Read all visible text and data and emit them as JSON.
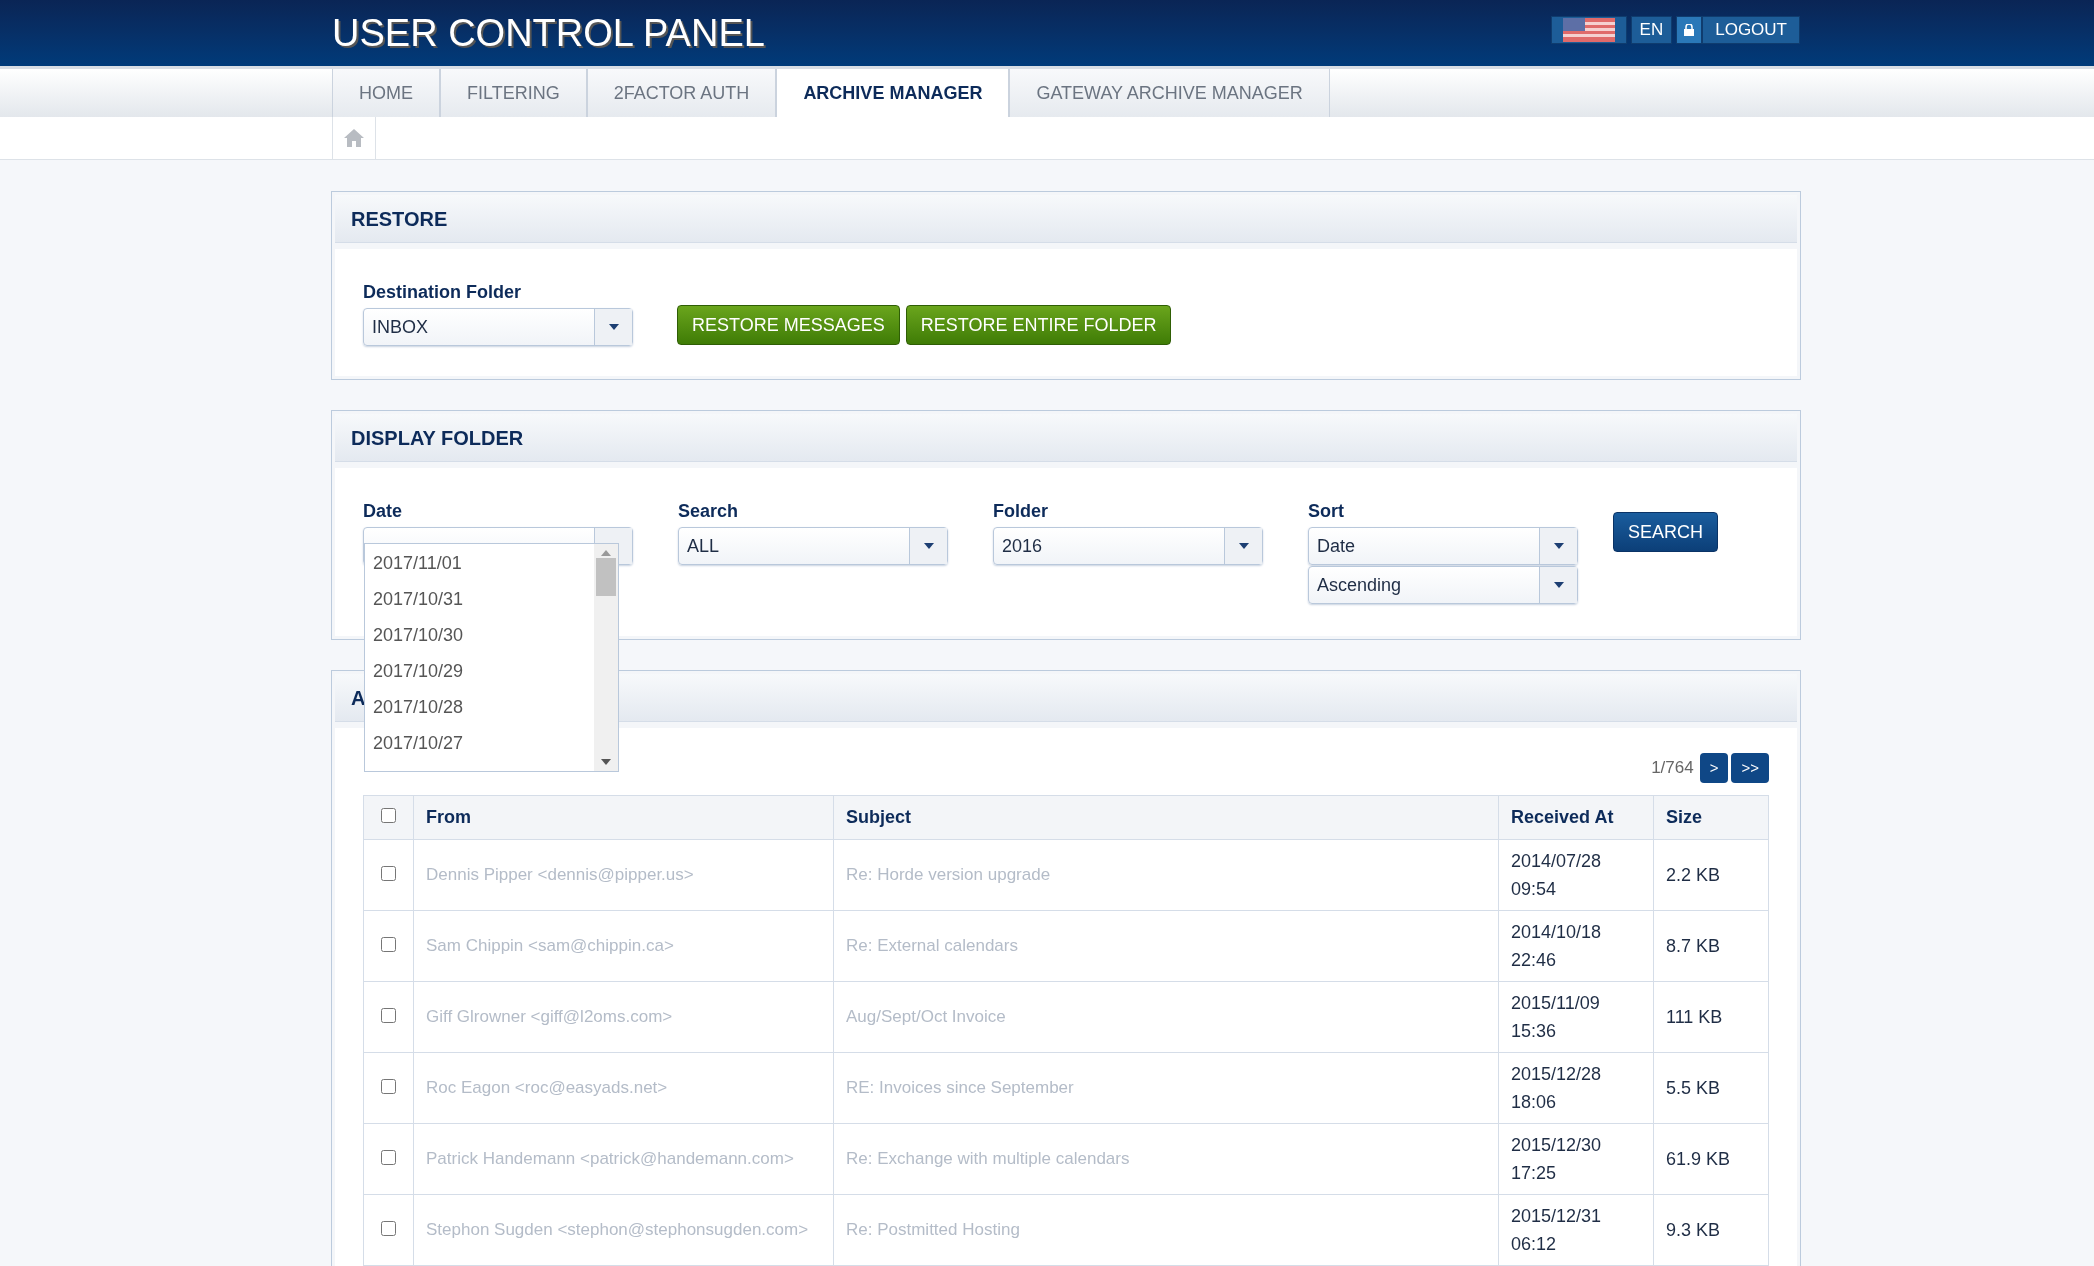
{
  "header": {
    "title": "USER CONTROL PANEL",
    "language": "EN",
    "logout": "LOGOUT"
  },
  "tabs": [
    {
      "label": "HOME",
      "selected": false
    },
    {
      "label": "FILTERING",
      "selected": false
    },
    {
      "label": "2FACTOR AUTH",
      "selected": false
    },
    {
      "label": "ARCHIVE MANAGER",
      "selected": true
    },
    {
      "label": "GATEWAY ARCHIVE MANAGER",
      "selected": false
    }
  ],
  "restore": {
    "title": "RESTORE",
    "destination_label": "Destination Folder",
    "destination_value": "INBOX",
    "buttons": [
      "RESTORE MESSAGES",
      "RESTORE ENTIRE FOLDER"
    ]
  },
  "display_folder": {
    "title": "DISPLAY FOLDER",
    "date_label": "Date",
    "date_options": [
      "2017/11/01",
      "2017/10/31",
      "2017/10/30",
      "2017/10/29",
      "2017/10/28",
      "2017/10/27"
    ],
    "search_label": "Search",
    "search_value": "ALL",
    "folder_label": "Folder",
    "folder_value": "2016",
    "sort_label": "Sort",
    "sort_field": "Date",
    "sort_order": "Ascending",
    "search_button": "SEARCH"
  },
  "archive": {
    "title": "A",
    "select_all_checked": false,
    "page": "1/764",
    "next": ">",
    "last": ">>",
    "columns": [
      "From",
      "Subject",
      "Received At",
      "Size"
    ],
    "rows": [
      {
        "checked": false,
        "from": "Dennis Pipper <dennis@pipper.us>",
        "subject": "Re: Horde version upgrade",
        "received": [
          "2014/07/28",
          "09:54"
        ],
        "size": "2.2 KB"
      },
      {
        "checked": false,
        "from": "Sam Chippin <sam@chippin.ca>",
        "subject": "Re: External calendars",
        "received": [
          "2014/10/18",
          "22:46"
        ],
        "size": "8.7 KB"
      },
      {
        "checked": false,
        "from": "Giff Glrowner <giff@l2oms.com>",
        "subject": "Aug/Sept/Oct Invoice",
        "received": [
          "2015/11/09",
          "15:36"
        ],
        "size": "111 KB"
      },
      {
        "checked": false,
        "from": "Roc Eagon <roc@easyads.net>",
        "subject": "RE: Invoices since September",
        "received": [
          "2015/12/28",
          "18:06"
        ],
        "size": "5.5 KB"
      },
      {
        "checked": false,
        "from": "Patrick Handemann <patrick@handemann.com>",
        "subject": "Re: Exchange with multiple calendars",
        "received": [
          "2015/12/30",
          "17:25"
        ],
        "size": "61.9 KB"
      },
      {
        "checked": false,
        "from": "Stephon Sugden <stephon@stephonsugden.com>",
        "subject": "Re: Postmitted Hosting",
        "received": [
          "2015/12/31",
          "06:12"
        ],
        "size": "9.3 KB"
      }
    ]
  }
}
